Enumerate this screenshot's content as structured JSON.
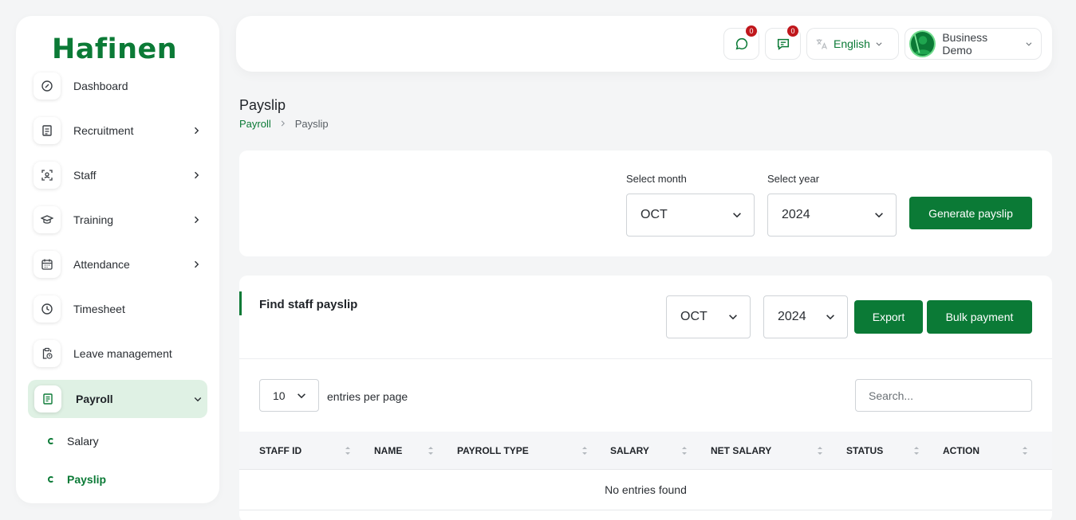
{
  "brand": {
    "logo_text": "Hafinen",
    "accent_color": "#0b7a36"
  },
  "sidebar": {
    "items": [
      {
        "label": "Dashboard",
        "icon": "dashboard-gauge-icon",
        "has_chevron": false
      },
      {
        "label": "Recruitment",
        "icon": "clipboard-doc-icon",
        "has_chevron": true
      },
      {
        "label": "Staff",
        "icon": "user-scan-icon",
        "has_chevron": true
      },
      {
        "label": "Training",
        "icon": "graduation-cap-icon",
        "has_chevron": true
      },
      {
        "label": "Attendance",
        "icon": "calendar-icon",
        "has_chevron": true
      },
      {
        "label": "Timesheet",
        "icon": "clock-icon",
        "has_chevron": false
      },
      {
        "label": "Leave management",
        "icon": "clipboard-clock-icon",
        "has_chevron": false
      },
      {
        "label": "Payroll",
        "icon": "receipt-icon",
        "has_chevron": true,
        "expanded": true
      }
    ],
    "sub_items": [
      {
        "label": "Salary",
        "active": false
      },
      {
        "label": "Payslip",
        "active": true
      }
    ]
  },
  "header": {
    "messages_count": "0",
    "notifications_count": "0",
    "language": "English",
    "user_name": "Business Demo"
  },
  "page": {
    "title": "Payslip",
    "breadcrumb": {
      "parent": "Payroll",
      "current": "Payslip"
    }
  },
  "generate": {
    "month_label": "Select month",
    "month_value": "OCT",
    "year_label": "Select year",
    "year_value": "2024",
    "button_label": "Generate payslip"
  },
  "find": {
    "title": "Find staff payslip",
    "month_value": "OCT",
    "year_value": "2024",
    "export_label": "Export",
    "bulk_label": "Bulk payment",
    "entries_value": "10",
    "entries_label": "entries per page",
    "search_placeholder": "Search..."
  },
  "table": {
    "columns": [
      "STAFF ID",
      "NAME",
      "PAYROLL TYPE",
      "SALARY",
      "NET SALARY",
      "STATUS",
      "ACTION"
    ],
    "empty_text": "No entries found"
  }
}
